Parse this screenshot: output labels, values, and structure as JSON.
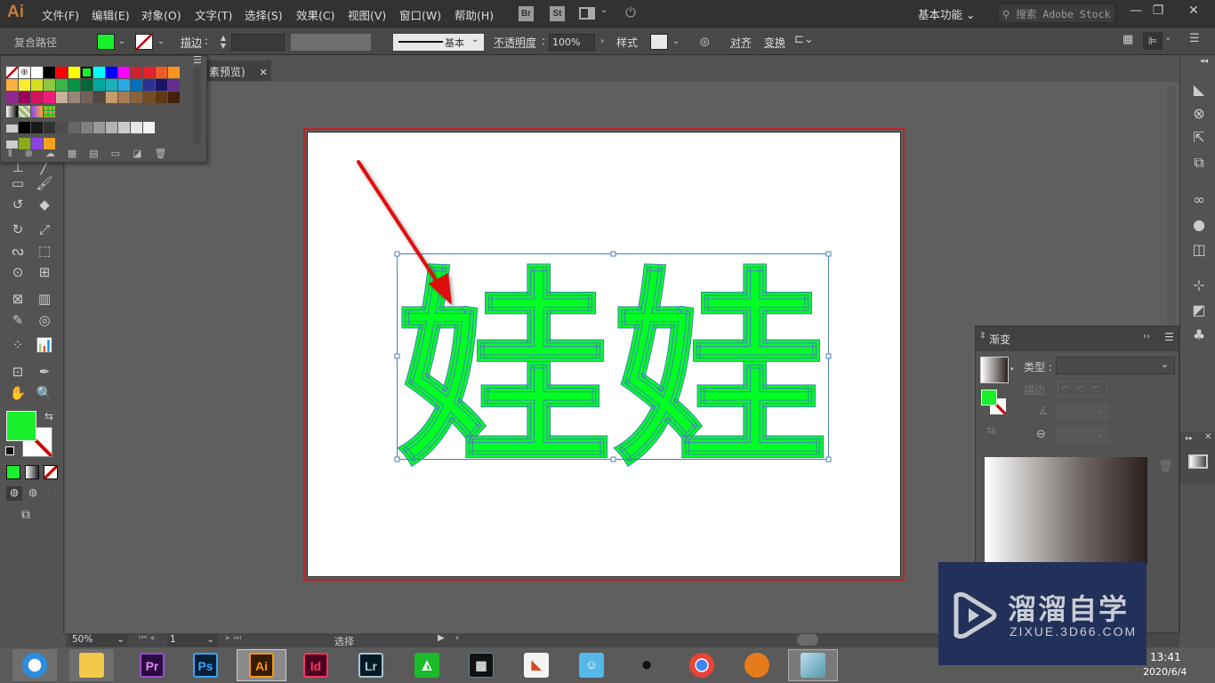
{
  "app": {
    "logo": "Ai",
    "workspace": "基本功能",
    "stock_search_placeholder": "搜索 Adobe Stock"
  },
  "menu": [
    "文件(F)",
    "编辑(E)",
    "对象(O)",
    "文字(T)",
    "选择(S)",
    "效果(C)",
    "视图(V)",
    "窗口(W)",
    "帮助(H)"
  ],
  "app_buttons": [
    "Br",
    "St"
  ],
  "window_controls": {
    "minimize": "—",
    "restore": "❐",
    "close": "✕"
  },
  "control_bar": {
    "object_type": "复合路径",
    "fill_color": "#19f02b",
    "stroke_label": "描边",
    "stroke_value": "",
    "brush_label": "基本",
    "opacity_label": "不透明度",
    "opacity_value": "100%",
    "style_label": "样式",
    "align_label": "对齐",
    "transform_label": "变换"
  },
  "doc_tab": {
    "title": "素预览)",
    "close": "✕"
  },
  "swatches": {
    "rows": [
      [
        "none",
        "reg",
        "#ffffff",
        "#000000",
        "#ff0000",
        "#ffff00",
        "#19f02b",
        "#00ffff",
        "#0000ff",
        "#ff00ff",
        "#d4202a",
        "#e8202a",
        "#ee5a28",
        "#f7931e"
      ],
      [
        "#fbb040",
        "#f9ed32",
        "#d7df23",
        "#8dc63f",
        "#39b54a",
        "#009444",
        "#006837",
        "#00a99d",
        "#1cb0b8",
        "#29abe2",
        "#0071bc",
        "#2e3192",
        "#1b1464",
        "#662d91"
      ],
      [
        "#93278f",
        "#9e005d",
        "#d4145a",
        "#ed1e79",
        "#c7b299",
        "#998675",
        "#736357",
        "#534741",
        "#c69c6d",
        "#a67c52",
        "#8c6239",
        "#754c24",
        "#603813",
        "#42210b"
      ],
      [
        "grad1",
        "grad2",
        "grad3",
        "pattern"
      ],
      [
        "folder",
        "#000000",
        "#1a1a1a",
        "#333333",
        "#4d4d4d",
        "#666666",
        "#808080",
        "#999999",
        "#b3b3b3",
        "#cccccc",
        "#e6e6e6",
        "#f2f2f2"
      ],
      [
        "folder",
        "#8cab17",
        "#8b44e0",
        "#f7a21b"
      ]
    ]
  },
  "canvas": {
    "text": "娃娃",
    "fill": "#00ff22",
    "arrow_color": "#e01010"
  },
  "gradient_panel": {
    "title": "渐变",
    "type_label": "类型",
    "type_value": "",
    "stroke_label": "描边",
    "gradient_from": "#ffffff",
    "gradient_to": "#2b1f1e"
  },
  "status_bar": {
    "zoom": "50%",
    "artboard": "1",
    "tool": "选择"
  },
  "taskbar": {
    "apps": [
      {
        "name": "browser",
        "label": ""
      },
      {
        "name": "file-explorer",
        "label": ""
      },
      {
        "name": "premiere",
        "label": "Pr",
        "color": "#2a0a3f",
        "fg": "#e08cf6",
        "border": "#9a4bd1"
      },
      {
        "name": "photoshop",
        "label": "Ps",
        "color": "#061e33",
        "fg": "#31a8ff",
        "border": "#31a8ff"
      },
      {
        "name": "illustrator",
        "label": "Ai",
        "color": "#331c00",
        "fg": "#ff9a00",
        "border": "#ff9a00"
      },
      {
        "name": "indesign",
        "label": "Id",
        "color": "#49021f",
        "fg": "#ff3366",
        "border": "#ff3366"
      },
      {
        "name": "lightroom",
        "label": "Lr",
        "color": "#001a23",
        "fg": "#a7c4d3",
        "border": "#a7c4d3"
      }
    ],
    "time": "13:41",
    "date": "2020/6/4"
  },
  "watermark": {
    "title": "溜溜自学",
    "url": "ZIXUE.3D66.COM"
  }
}
